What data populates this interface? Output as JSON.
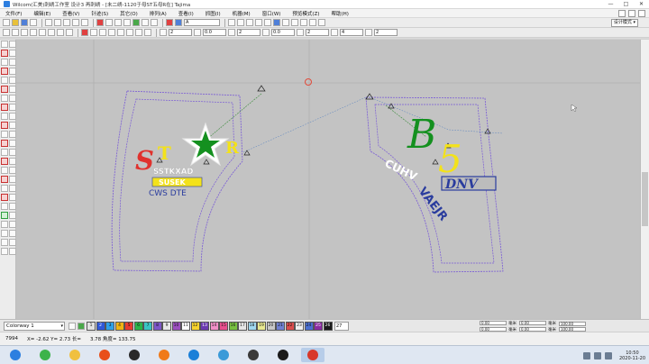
{
  "window": {
    "title": "Wilcom(汇美)刺绣工作室  设计3 再刺绣 - [未二绣-1120于母ST五母R在] Tajima",
    "minimize": "—",
    "maximize": "□",
    "close": "✕"
  },
  "menu": [
    "文件(F)",
    "编辑(E)",
    "查看(V)",
    "针迹(S)",
    "其它(O)",
    "排列(A)",
    "查看(I)",
    "抓图(I)",
    "机器(M)",
    "窗口(W)",
    "预览模式(Z)",
    "帮助(H)"
  ],
  "toolbar": {
    "font_value": "A",
    "num_fields": [
      "2",
      "0.0",
      "2",
      "0.0",
      "2",
      "4",
      "2"
    ],
    "design_mode": "设计模式 ▾"
  },
  "colors": {
    "canvas": "#c3c3c3",
    "outline": "#7a5bd6",
    "link": "#3b8b3b",
    "star_red": "#e0322e",
    "star_yellow": "#f3e21a",
    "b5_green": "#14901f",
    "dnv_blue": "#2a3c9e"
  },
  "designs": {
    "left": {
      "star_text": [
        "S",
        "T",
        "R"
      ],
      "line1": "SSTKXAD",
      "line2": "SUSEK",
      "line3": "CWS DTE"
    },
    "right": {
      "b_letter": "B",
      "five_letter": "5",
      "dnv": "DNV",
      "arc1": "CUHV",
      "arc2": "VAEJR"
    }
  },
  "palette": {
    "colorway": "Colorway 1",
    "swatches": [
      {
        "label": "1",
        "color": "#e1e1e1"
      },
      {
        "label": "2",
        "color": "#2f57d8"
      },
      {
        "label": "3",
        "color": "#2fa0e8"
      },
      {
        "label": "4",
        "color": "#f0b414"
      },
      {
        "label": "5",
        "color": "#e83b30"
      },
      {
        "label": "6",
        "color": "#2cb44a"
      },
      {
        "label": "7",
        "color": "#3ac4c4"
      },
      {
        "label": "8",
        "color": "#7d56c8"
      },
      {
        "label": "9",
        "color": "#e8e8e8"
      },
      {
        "label": "10",
        "color": "#9b4fbe"
      },
      {
        "label": "11",
        "color": "#ffffff"
      },
      {
        "label": "12",
        "color": "#f7d330"
      },
      {
        "label": "13",
        "color": "#6a3ab0"
      },
      {
        "label": "14",
        "color": "#f090c8"
      },
      {
        "label": "15",
        "color": "#e84f8e"
      },
      {
        "label": "16",
        "color": "#78c040"
      },
      {
        "label": "17",
        "color": "#e6e6e6"
      },
      {
        "label": "18",
        "color": "#a0d8f0"
      },
      {
        "label": "19",
        "color": "#e8e890"
      },
      {
        "label": "20",
        "color": "#c8c8c8"
      },
      {
        "label": "21",
        "color": "#7080d0"
      },
      {
        "label": "22",
        "color": "#d94c4c"
      },
      {
        "label": "23",
        "color": "#f0f0f0"
      },
      {
        "label": "24",
        "color": "#4a6fd0"
      },
      {
        "label": "25",
        "color": "#8a2ca0"
      },
      {
        "label": "26",
        "color": "#1a1a1a"
      }
    ],
    "input_value": "27"
  },
  "coords": {
    "fields": [
      "0.00",
      "0.00",
      "0.00",
      "0.00"
    ],
    "units": [
      "毫米",
      "毫米",
      "毫米",
      "毫米"
    ],
    "zoom_fields": [
      "100.00",
      "100.00"
    ]
  },
  "status": {
    "stitches": "7994",
    "x": "X= -2.62 Y= 2.73 长=",
    "length": "3.78 角度= 133.75"
  },
  "taskbar": {
    "apps": [
      {
        "name": "windows-start",
        "color": "#2d7fe0"
      },
      {
        "name": "browser-green",
        "color": "#3db34a"
      },
      {
        "name": "file-explorer",
        "color": "#f0c040"
      },
      {
        "name": "media-player",
        "color": "#e84f1a"
      },
      {
        "name": "qq",
        "color": "#2a2a2a"
      },
      {
        "name": "search-app",
        "color": "#f07a1a"
      },
      {
        "name": "edge-browser",
        "color": "#1a7fd8"
      },
      {
        "name": "sky-app",
        "color": "#3a9ad8"
      },
      {
        "name": "terminal-app",
        "color": "#3a3a3a"
      },
      {
        "name": "chat-app",
        "color": "#1a1a1a"
      },
      {
        "name": "embroidery-app",
        "color": "#d8382a"
      }
    ],
    "clock_time": "10:50",
    "clock_date": "2020-11-20"
  }
}
